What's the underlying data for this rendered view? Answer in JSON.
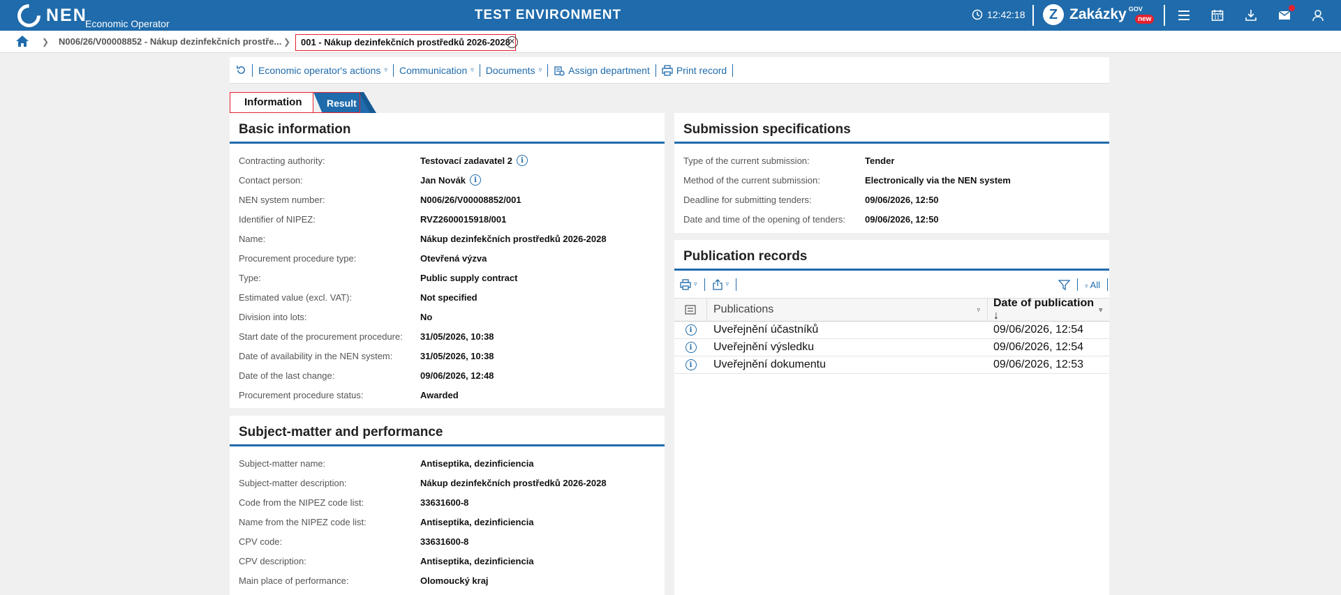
{
  "header": {
    "logo": "NEN",
    "logo_sub": "Economic Operator",
    "env_title": "TEST ENVIRONMENT",
    "time": "12:42:18",
    "brand": "Zakázky",
    "brand_gov": "GOV",
    "brand_new": "new",
    "icons": [
      "menu-icon",
      "calendar-icon",
      "download-icon",
      "mail-icon",
      "user-icon"
    ]
  },
  "breadcrumb": {
    "item1": "N006/26/V00008852 - Nákup dezinfekčních prostře...",
    "active": "001 - Nákup dezinfekčních prostředků 2026-2028"
  },
  "toolbar": {
    "economic_actions": "Economic operator's actions",
    "communication": "Communication",
    "documents": "Documents",
    "assign_department": "Assign department",
    "print_record": "Print record"
  },
  "tabs": {
    "information": "Information",
    "result": "Result"
  },
  "basic_info": {
    "title": "Basic information",
    "rows": [
      {
        "label": "Contracting authority:",
        "value": "Testovací zadavatel 2"
      },
      {
        "label": "Contact person:",
        "value": "Jan Novák"
      },
      {
        "label": "NEN system number:",
        "value": "N006/26/V00008852/001"
      },
      {
        "label": "Identifier of NIPEZ:",
        "value": "RVZ2600015918/001"
      },
      {
        "label": "Name:",
        "value": "Nákup dezinfekčních prostředků 2026-2028"
      },
      {
        "label": "Procurement procedure type:",
        "value": "Otevřená výzva"
      },
      {
        "label": "Type:",
        "value": "Public supply contract"
      },
      {
        "label": "Estimated value (excl. VAT):",
        "value": "Not specified"
      },
      {
        "label": "Division into lots:",
        "value": "No"
      },
      {
        "label": "Start date of the procurement procedure:",
        "value": "31/05/2026, 10:38"
      },
      {
        "label": "Date of availability in the NEN system:",
        "value": "31/05/2026, 10:38"
      },
      {
        "label": "Date of the last change:",
        "value": "09/06/2026, 12:48"
      },
      {
        "label": "Procurement procedure status:",
        "value": "Awarded"
      }
    ]
  },
  "subject_matter": {
    "title": "Subject-matter and performance",
    "rows": [
      {
        "label": "Subject-matter name:",
        "value": "Antiseptika, dezinficiencia"
      },
      {
        "label": "Subject-matter description:",
        "value": "Nákup dezinfekčních prostředků 2026-2028"
      },
      {
        "label": "Code from the NIPEZ code list:",
        "value": "33631600-8"
      },
      {
        "label": "Name from the NIPEZ code list:",
        "value": "Antiseptika, dezinficiencia"
      },
      {
        "label": "CPV code:",
        "value": "33631600-8"
      },
      {
        "label": "CPV description:",
        "value": "Antiseptika, dezinficiencia"
      },
      {
        "label": "Main place of performance:",
        "value": "Olomoucký kraj"
      }
    ]
  },
  "submission": {
    "title": "Submission specifications",
    "rows": [
      {
        "label": "Type of the current submission:",
        "value": "Tender"
      },
      {
        "label": "Method of the current submission:",
        "value": "Electronically via the NEN system"
      },
      {
        "label": "Deadline for submitting tenders:",
        "value": "09/06/2026, 12:50"
      },
      {
        "label": "Date and time of the opening of tenders:",
        "value": "09/06/2026, 12:50"
      }
    ]
  },
  "publication": {
    "title": "Publication records",
    "filter_all": "All",
    "col_publications": "Publications",
    "col_date": "Date of publication",
    "rows": [
      {
        "name": "Uveřejnění účastníků",
        "date": "09/06/2026, 12:54"
      },
      {
        "name": "Uveřejnění výsledku",
        "date": "09/06/2026, 12:54"
      },
      {
        "name": "Uveřejnění dokumentu",
        "date": "09/06/2026, 12:53"
      }
    ]
  },
  "colors": {
    "primary": "#1f6bab",
    "highlight_border": "#e5202e",
    "badge": "#e5202e"
  }
}
